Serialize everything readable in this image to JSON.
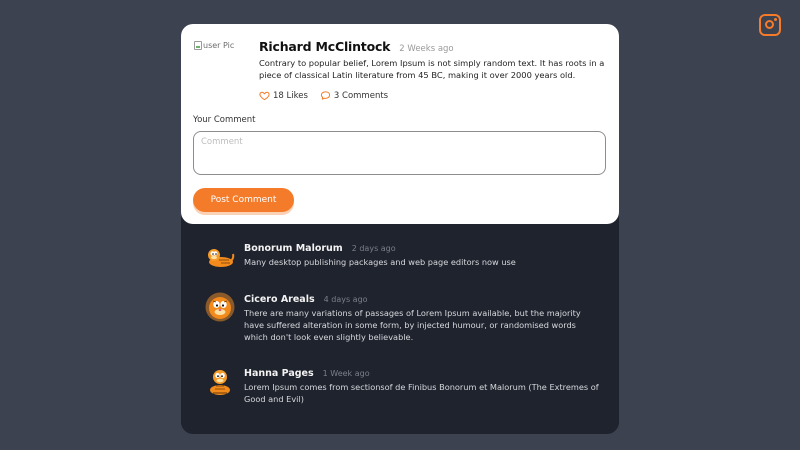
{
  "post": {
    "avatar_alt": "user Pic",
    "author": "Richard McClintock",
    "time": "2 Weeks ago",
    "body": "Contrary to popular belief, Lorem Ipsum is not simply random text. It has roots in a piece of classical Latin literature from 45 BC, making it over 2000 years old.",
    "likes": "18 Likes",
    "comments": "3 Comments"
  },
  "comment_form": {
    "label": "Your Comment",
    "placeholder": "Comment",
    "value": "",
    "submit_label": "Post Comment"
  },
  "replies": [
    {
      "name": "Bonorum Malorum",
      "time": "2 days ago",
      "text": "Many desktop publishing packages and web page editors now use",
      "avatar_icon": "garfield-lying-avatar"
    },
    {
      "name": "Cicero Areals",
      "time": "4 days ago",
      "text": "There are many variations of passages of Lorem Ipsum available, but the majority have suffered alteration in some form, by injected humour, or randomised words which don't look even slightly believable.",
      "avatar_icon": "garfield-face-avatar"
    },
    {
      "name": "Hanna Pages",
      "time": "1 Week ago",
      "text": "Lorem Ipsum comes from sectionsof de Finibus Bonorum et Malorum (The Extremes of Good and Evil)",
      "avatar_icon": "garfield-sitting-avatar"
    }
  ],
  "social": {
    "icon": "instagram-icon"
  },
  "colors": {
    "accent": "#f47b2a",
    "page_bg": "#3d4250",
    "thread_bg": "#1f232d",
    "card_bg": "#ffffff"
  }
}
